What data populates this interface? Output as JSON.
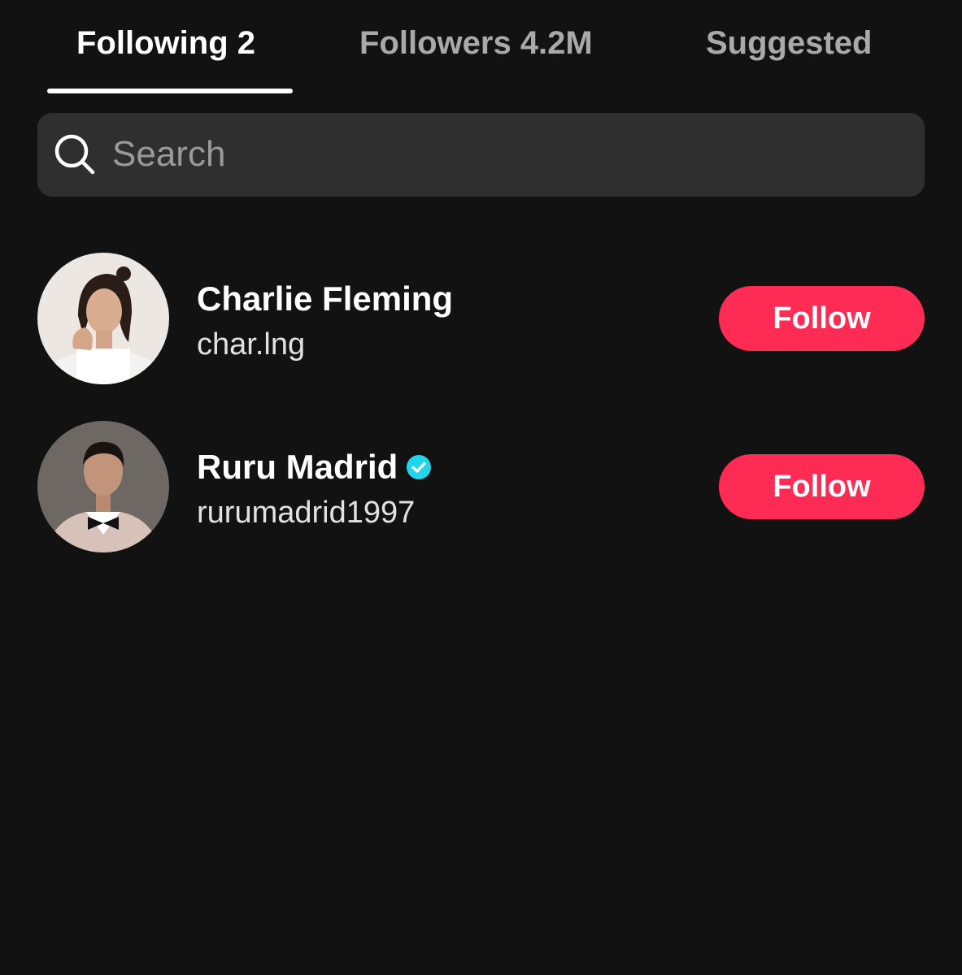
{
  "tabs": [
    {
      "label": "Following 2",
      "active": true
    },
    {
      "label": "Followers 4.2M",
      "active": false
    },
    {
      "label": "Suggested",
      "active": false
    }
  ],
  "search": {
    "placeholder": "Search",
    "value": "",
    "icon": "search-icon"
  },
  "users": [
    {
      "display_name": "Charlie Fleming",
      "username": "char.lng",
      "verified": false,
      "button_label": "Follow"
    },
    {
      "display_name": "Ruru Madrid",
      "username": "rurumadrid1997",
      "verified": true,
      "button_label": "Follow"
    }
  ],
  "colors": {
    "background": "#121212",
    "search_bg": "#2f2f2f",
    "follow_button": "#fe2c55",
    "verified_badge": "#20d5ec",
    "inactive_tab": "#a9a9a9"
  }
}
